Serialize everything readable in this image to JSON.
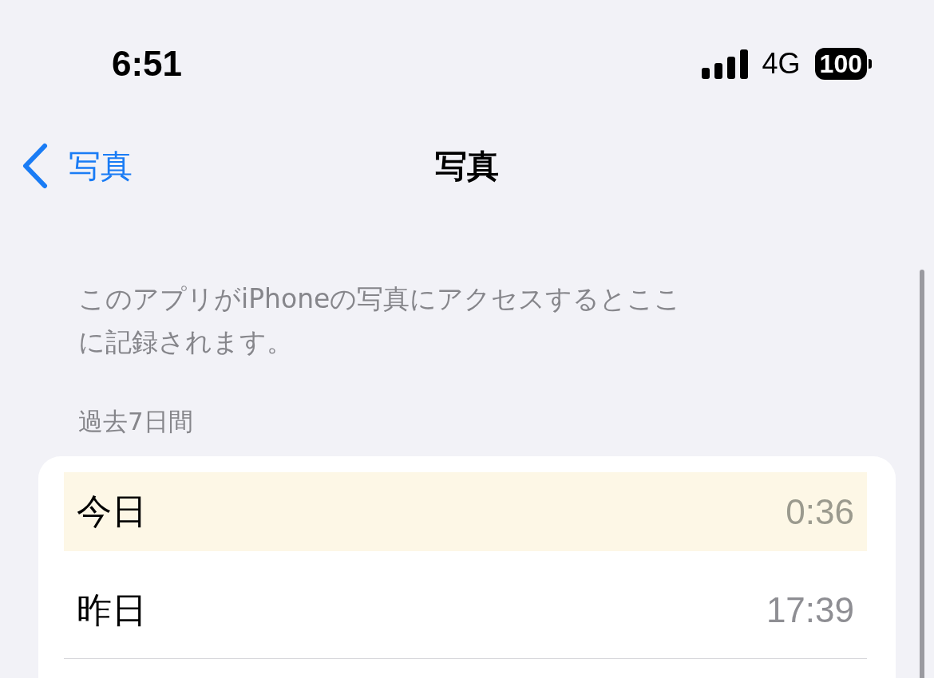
{
  "status_bar": {
    "time": "6:51",
    "network": "4G",
    "battery": "100"
  },
  "nav": {
    "back_label": "写真",
    "title": "写真"
  },
  "description": "このアプリがiPhoneの写真にアクセスするとここに記録されます。",
  "section": {
    "header": "過去7日間",
    "rows": [
      {
        "label": "今日",
        "time": "0:36",
        "highlighted": true
      },
      {
        "label": "昨日",
        "time": "17:39",
        "highlighted": false
      }
    ]
  }
}
